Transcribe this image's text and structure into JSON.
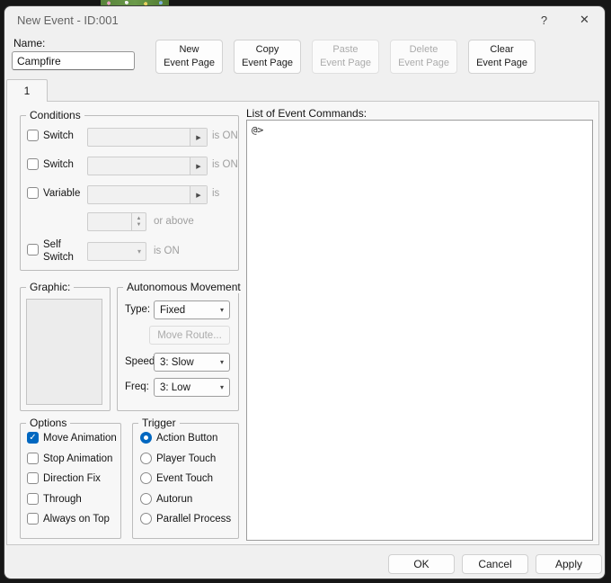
{
  "window": {
    "title": "New Event - ID:001",
    "help": "?",
    "close": "✕"
  },
  "name": {
    "label": "Name:",
    "value": "Campfire"
  },
  "page_buttons": {
    "new": "New\nEvent Page",
    "copy": "Copy\nEvent Page",
    "paste": "Paste\nEvent Page",
    "delete": "Delete\nEvent Page",
    "clear": "Clear\nEvent Page"
  },
  "tabs": {
    "tab1": "1"
  },
  "conditions": {
    "title": "Conditions",
    "switch1": {
      "label": "Switch",
      "suffix": "is ON",
      "checked": false,
      "value": ""
    },
    "switch2": {
      "label": "Switch",
      "suffix": "is ON",
      "checked": false,
      "value": ""
    },
    "variable": {
      "label": "Variable",
      "suffix": "is",
      "checked": false,
      "value": ""
    },
    "variable_value": {
      "value": "",
      "suffix": "or above"
    },
    "self_switch": {
      "label": "Self Switch",
      "suffix": "is ON",
      "checked": false,
      "value": ""
    }
  },
  "graphic": {
    "title": "Graphic:"
  },
  "movement": {
    "title": "Autonomous Movement",
    "type_label": "Type:",
    "type_value": "Fixed",
    "move_route": "Move Route...",
    "speed_label": "Speed:",
    "speed_value": "3: Slow",
    "freq_label": "Freq:",
    "freq_value": "3: Low"
  },
  "options": {
    "title": "Options",
    "items": [
      {
        "label": "Move Animation",
        "checked": true
      },
      {
        "label": "Stop Animation",
        "checked": false
      },
      {
        "label": "Direction Fix",
        "checked": false
      },
      {
        "label": "Through",
        "checked": false
      },
      {
        "label": "Always on Top",
        "checked": false
      }
    ]
  },
  "trigger": {
    "title": "Trigger",
    "items": [
      {
        "label": "Action Button",
        "selected": true
      },
      {
        "label": "Player Touch",
        "selected": false
      },
      {
        "label": "Event Touch",
        "selected": false
      },
      {
        "label": "Autorun",
        "selected": false
      },
      {
        "label": "Parallel Process",
        "selected": false
      }
    ]
  },
  "commands": {
    "label": "List of Event Commands:",
    "content": "@>"
  },
  "footer": {
    "ok": "OK",
    "cancel": "Cancel",
    "apply": "Apply"
  },
  "colors": {
    "accent": "#0067c0",
    "dialog_bg": "#f0f0f0",
    "outer_bg": "#161616"
  }
}
